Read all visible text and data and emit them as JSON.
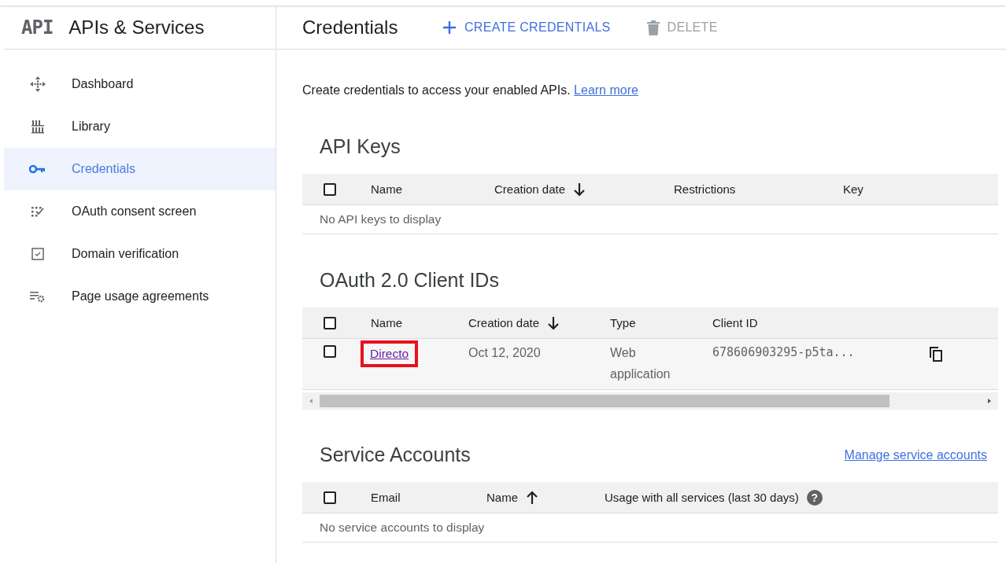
{
  "topbar": {
    "logo": "API",
    "title": "APIs & Services"
  },
  "sidebar": {
    "items": [
      {
        "label": "Dashboard",
        "selected": false
      },
      {
        "label": "Library",
        "selected": false
      },
      {
        "label": "Credentials",
        "selected": true
      },
      {
        "label": "OAuth consent screen",
        "selected": false
      },
      {
        "label": "Domain verification",
        "selected": false
      },
      {
        "label": "Page usage agreements",
        "selected": false
      }
    ]
  },
  "header": {
    "title": "Credentials",
    "actions": [
      {
        "label": "CREATE CREDENTIALS",
        "kind": "create",
        "disabled": false
      },
      {
        "label": "DELETE",
        "kind": "delete",
        "disabled": true
      }
    ]
  },
  "intro": {
    "text": "Create credentials to access your enabled APIs.",
    "link": "Learn more"
  },
  "api_keys": {
    "title": "API Keys",
    "all_checked": false,
    "columns": [
      {
        "label": "Name"
      },
      {
        "label": "Creation date",
        "sorted": true,
        "ascending": false
      },
      {
        "label": "Restrictions"
      },
      {
        "label": "Key"
      }
    ],
    "empty": "No API keys to display"
  },
  "oauth_clients": {
    "title": "OAuth 2.0 Client IDs",
    "all_checked": false,
    "columns": [
      {
        "label": "Name"
      },
      {
        "label": "Creation date",
        "sorted": true,
        "ascending": false
      },
      {
        "label": "Type"
      },
      {
        "label": "Client ID"
      }
    ],
    "rows": [
      {
        "checked": false,
        "name": "Directo",
        "highlighted": true,
        "date": "Oct 12, 2020",
        "type": "Web application",
        "client_id": "678606903295-p5ta..."
      }
    ]
  },
  "service_accounts": {
    "title": "Service Accounts",
    "link": "Manage service accounts",
    "all_checked": false,
    "columns": [
      {
        "label": "Email"
      },
      {
        "label": "Name",
        "sorted": true,
        "ascending": true
      },
      {
        "label": "Usage with all services (last 30 days)",
        "help": "?"
      }
    ],
    "empty": "No service accounts to display"
  }
}
